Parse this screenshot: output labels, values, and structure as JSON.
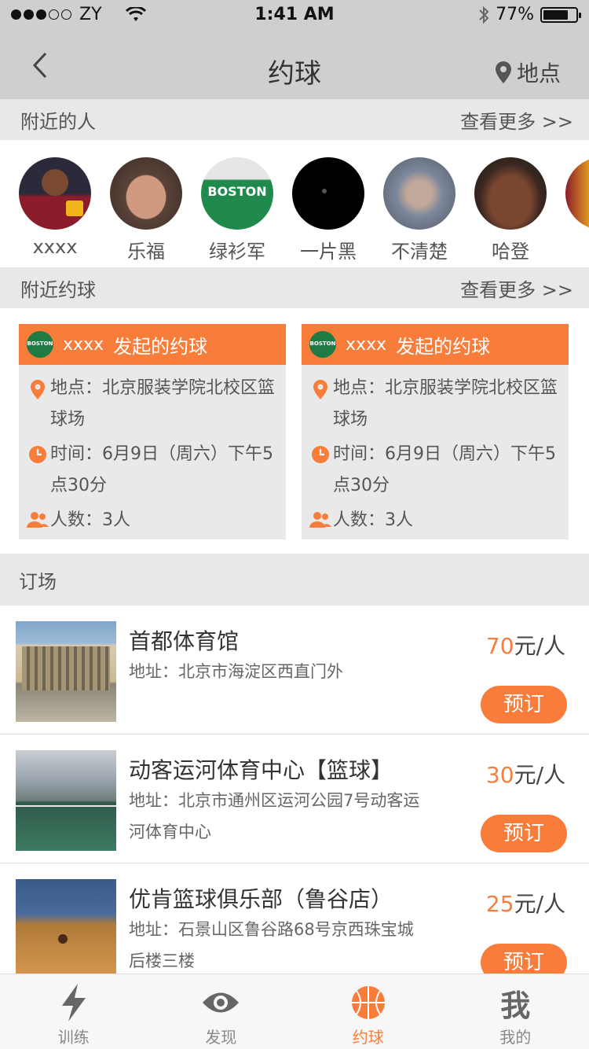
{
  "status": {
    "carrier": "ZY",
    "time": "1:41 AM",
    "battery": "77%",
    "battery_level": 0.77
  },
  "nav": {
    "title": "约球",
    "location_label": "地点"
  },
  "nearby_people": {
    "title": "附近的人",
    "more": "查看更多 >>",
    "people": [
      {
        "name": "xxxx"
      },
      {
        "name": "乐福"
      },
      {
        "name": "绿衫军"
      },
      {
        "name": "一片黑"
      },
      {
        "name": "不清楚"
      },
      {
        "name": "哈登"
      }
    ]
  },
  "nearby_games": {
    "title": "附近约球",
    "more": "查看更多 >>",
    "cards": [
      {
        "user": "xxxx",
        "action": "发起的约球",
        "location": "地点：北京服装学院北校区篮球场",
        "time": "时间：6月9日（周六）下午5点30分",
        "people": "人数：3人"
      },
      {
        "user": "xxxx",
        "action": "发起的约球",
        "location": "地点：北京服装学院北校区篮球场",
        "time": "时间：6月9日（周六）下午5点30分",
        "people": "人数：3人"
      }
    ]
  },
  "booking": {
    "title": "订场",
    "venues": [
      {
        "name": "首都体育馆",
        "address": "地址：北京市海淀区西直门外",
        "price": "70",
        "unit": "元/人",
        "button": "预订"
      },
      {
        "name": "动客运河体育中心【篮球】",
        "address": "地址：北京市通州区运河公园7号动客运河体育中心",
        "price": "30",
        "unit": "元/人",
        "button": "预订"
      },
      {
        "name": "优肯篮球俱乐部（鲁谷店）",
        "address": "地址：石景山区鲁谷路68号京西珠宝城后楼三楼",
        "price": "25",
        "unit": "元/人",
        "button": "预订"
      }
    ]
  },
  "tabs": [
    {
      "label": "训练",
      "icon": "lightning-icon"
    },
    {
      "label": "发现",
      "icon": "eye-icon"
    },
    {
      "label": "约球",
      "icon": "basketball-icon",
      "active": true
    },
    {
      "label": "我的",
      "icon": "me-icon"
    }
  ],
  "colors": {
    "accent": "#f97d3a",
    "header_gray": "#cfcfcf",
    "section_gray": "#e8e8e8"
  }
}
